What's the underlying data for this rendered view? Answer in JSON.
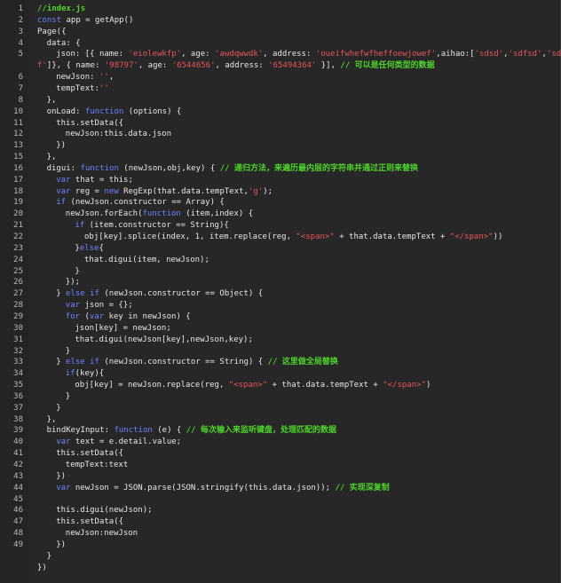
{
  "colors": {
    "background": "#272727",
    "keyword": "#6a84ff",
    "string": "#e8545a",
    "comment": "#4ed42a",
    "text": "#e6e6e6",
    "line_number": "#b8b8b8"
  },
  "editor": {
    "lines": [
      {
        "n": "1",
        "i": 0,
        "t": [
          [
            "cmt",
            "//index.js"
          ]
        ]
      },
      {
        "n": "2",
        "i": 0,
        "t": [
          [
            "kw",
            "const"
          ],
          [
            "txt",
            " app = getApp()"
          ]
        ]
      },
      {
        "n": "3",
        "i": 0,
        "t": [
          [
            "txt",
            "Page({"
          ]
        ]
      },
      {
        "n": "4",
        "i": 1,
        "t": [
          [
            "txt",
            "data: {"
          ]
        ]
      },
      {
        "n": "5",
        "i": 2,
        "t": [
          [
            "txt",
            "json: [{ name: "
          ],
          [
            "str",
            "'eiolewkfp'"
          ],
          [
            "txt",
            ", age: "
          ],
          [
            "str",
            "'awdqwwdk'"
          ],
          [
            "txt",
            ", address: "
          ],
          [
            "str",
            "'oueifwhefwfheffoewjowef'"
          ],
          [
            "txt",
            ",aihao:["
          ],
          [
            "str",
            "'sdsd'"
          ],
          [
            "txt",
            ","
          ],
          [
            "str",
            "'sdfsd'"
          ],
          [
            "txt",
            ","
          ],
          [
            "str",
            "'sds"
          ]
        ]
      },
      {
        "n": "",
        "i": 0,
        "t": [
          [
            "str",
            "f'"
          ],
          [
            "txt",
            "]}, { name: "
          ],
          [
            "str",
            "'98797'"
          ],
          [
            "txt",
            ", age: "
          ],
          [
            "str",
            "'6544656'"
          ],
          [
            "txt",
            ", address: "
          ],
          [
            "str",
            "'65494364'"
          ],
          [
            "txt",
            " }], "
          ],
          [
            "cmt",
            "// 可以是任何类型的数据"
          ]
        ]
      },
      {
        "n": "6",
        "i": 2,
        "t": [
          [
            "txt",
            "newJson: "
          ],
          [
            "str",
            "''"
          ],
          [
            "txt",
            ","
          ]
        ]
      },
      {
        "n": "7",
        "i": 2,
        "t": [
          [
            "txt",
            "tempText:"
          ],
          [
            "str",
            "''"
          ]
        ]
      },
      {
        "n": "8",
        "i": 1,
        "t": [
          [
            "txt",
            "},"
          ]
        ]
      },
      {
        "n": "10",
        "i": 1,
        "t": [
          [
            "txt",
            "onLoad: "
          ],
          [
            "kw",
            "function"
          ],
          [
            "txt",
            " (options) {"
          ]
        ]
      },
      {
        "n": "11",
        "i": 2,
        "t": [
          [
            "txt",
            "this.setData({"
          ]
        ]
      },
      {
        "n": "12",
        "i": 3,
        "t": [
          [
            "txt",
            "newJson:this.data.json"
          ]
        ]
      },
      {
        "n": "13",
        "i": 2,
        "t": [
          [
            "txt",
            "})"
          ]
        ]
      },
      {
        "n": "15",
        "i": 1,
        "t": [
          [
            "txt",
            "},"
          ]
        ]
      },
      {
        "n": "16",
        "i": 1,
        "t": [
          [
            "txt",
            "digui: "
          ],
          [
            "kw",
            "function"
          ],
          [
            "txt",
            " (newJson,obj,key) { "
          ],
          [
            "cmt",
            "// 递归方法，来遍历最内层的字符串并通过正则来替换"
          ]
        ]
      },
      {
        "n": "17",
        "i": 2,
        "t": [
          [
            "kw",
            "var"
          ],
          [
            "txt",
            " that = this;"
          ]
        ]
      },
      {
        "n": "18",
        "i": 2,
        "t": [
          [
            "kw",
            "var"
          ],
          [
            "txt",
            " reg = "
          ],
          [
            "kw",
            "new"
          ],
          [
            "txt",
            " RegExp(that.data.tempText,"
          ],
          [
            "str",
            "'g'"
          ],
          [
            "txt",
            ");"
          ]
        ]
      },
      {
        "n": "19",
        "i": 2,
        "t": [
          [
            "kw",
            "if"
          ],
          [
            "txt",
            " (newJson.constructor == Array) {"
          ]
        ]
      },
      {
        "n": "20",
        "i": 3,
        "t": [
          [
            "txt",
            "newJson.forEach("
          ],
          [
            "kw",
            "function"
          ],
          [
            "txt",
            " (item,index) {"
          ]
        ]
      },
      {
        "n": "21",
        "i": 4,
        "t": [
          [
            "kw",
            "if"
          ],
          [
            "txt",
            " (item.constructor == String){"
          ]
        ]
      },
      {
        "n": "22",
        "i": 5,
        "t": [
          [
            "txt",
            "obj[key].splice(index, 1, item.replace(reg, "
          ],
          [
            "str",
            "\"<span>\""
          ],
          [
            "txt",
            " + that.data.tempText + "
          ],
          [
            "str",
            "\"</span>\""
          ],
          [
            "txt",
            "))"
          ]
        ]
      },
      {
        "n": "23",
        "i": 4,
        "t": [
          [
            "txt",
            "}"
          ],
          [
            "kw",
            "else"
          ],
          [
            "txt",
            "{"
          ]
        ]
      },
      {
        "n": "24",
        "i": 5,
        "t": [
          [
            "txt",
            "that.digui(item, newJson);"
          ]
        ]
      },
      {
        "n": "25",
        "i": 4,
        "t": [
          [
            "txt",
            "}"
          ]
        ]
      },
      {
        "n": "26",
        "i": 3,
        "t": [
          [
            "txt",
            "});"
          ]
        ]
      },
      {
        "n": "27",
        "i": 2,
        "t": [
          [
            "txt",
            "} "
          ],
          [
            "kw",
            "else if"
          ],
          [
            "txt",
            " (newJson.constructor == Object) {"
          ]
        ]
      },
      {
        "n": "28",
        "i": 3,
        "t": [
          [
            "kw",
            "var"
          ],
          [
            "txt",
            " json = {};"
          ]
        ]
      },
      {
        "n": "29",
        "i": 3,
        "t": [
          [
            "kw",
            "for"
          ],
          [
            "txt",
            " ("
          ],
          [
            "kw",
            "var"
          ],
          [
            "txt",
            " key in newJson) {"
          ]
        ]
      },
      {
        "n": "30",
        "i": 4,
        "t": [
          [
            "txt",
            "json[key] = newJson;"
          ]
        ]
      },
      {
        "n": "31",
        "i": 4,
        "t": [
          [
            "txt",
            "that.digui(newJson[key],newJson,key);"
          ]
        ]
      },
      {
        "n": "32",
        "i": 3,
        "t": [
          [
            "txt",
            "}"
          ]
        ]
      },
      {
        "n": "33",
        "i": 2,
        "t": [
          [
            "txt",
            "} "
          ],
          [
            "kw",
            "else if"
          ],
          [
            "txt",
            " (newJson.constructor == String) { "
          ],
          [
            "cmt",
            "// 这里做全局替换"
          ]
        ]
      },
      {
        "n": "34",
        "i": 3,
        "t": [
          [
            "kw",
            "if"
          ],
          [
            "txt",
            "(key){"
          ]
        ]
      },
      {
        "n": "35",
        "i": 4,
        "t": [
          [
            "txt",
            "obj[key] = newJson.replace(reg, "
          ],
          [
            "str",
            "\"<span>\""
          ],
          [
            "txt",
            " + that.data.tempText + "
          ],
          [
            "str",
            "\"</span>\""
          ],
          [
            "txt",
            ")"
          ]
        ]
      },
      {
        "n": "36",
        "i": 3,
        "t": [
          [
            "txt",
            "}"
          ]
        ]
      },
      {
        "n": "37",
        "i": 2,
        "t": [
          [
            "txt",
            "}"
          ]
        ]
      },
      {
        "n": "38",
        "i": 1,
        "t": [
          [
            "txt",
            "},"
          ]
        ]
      },
      {
        "n": "39",
        "i": 1,
        "t": [
          [
            "txt",
            "bindKeyInput: "
          ],
          [
            "kw",
            "function"
          ],
          [
            "txt",
            " (e) { "
          ],
          [
            "cmt",
            "// 每次输入来监听键盘，处理匹配的数据"
          ]
        ]
      },
      {
        "n": "40",
        "i": 2,
        "t": [
          [
            "kw",
            "var"
          ],
          [
            "txt",
            " text = e.detail.value;"
          ]
        ]
      },
      {
        "n": "41",
        "i": 2,
        "t": [
          [
            "txt",
            "this.setData({"
          ]
        ]
      },
      {
        "n": "42",
        "i": 3,
        "t": [
          [
            "txt",
            "tempText:text"
          ]
        ]
      },
      {
        "n": "43",
        "i": 2,
        "t": [
          [
            "txt",
            "})"
          ]
        ]
      },
      {
        "n": "44",
        "i": 2,
        "t": [
          [
            "kw",
            "var"
          ],
          [
            "txt",
            " newJson = JSON.parse(JSON.stringify(this.data.json)); "
          ],
          [
            "cmt",
            "// 实现深复制"
          ]
        ]
      },
      {
        "n": "45",
        "i": 0,
        "t": []
      },
      {
        "n": "46",
        "i": 2,
        "t": [
          [
            "txt",
            "this.digui(newJson);"
          ]
        ]
      },
      {
        "n": "47",
        "i": 2,
        "t": [
          [
            "txt",
            "this.setData({"
          ]
        ]
      },
      {
        "n": "48",
        "i": 3,
        "t": [
          [
            "txt",
            "newJson:newJson"
          ]
        ]
      },
      {
        "n": "49",
        "i": 2,
        "t": [
          [
            "txt",
            "})"
          ]
        ]
      },
      {
        "n": "",
        "i": 1,
        "t": [
          [
            "txt",
            "}"
          ]
        ]
      },
      {
        "n": "",
        "i": 0,
        "t": [
          [
            "txt",
            "})"
          ]
        ]
      }
    ]
  }
}
